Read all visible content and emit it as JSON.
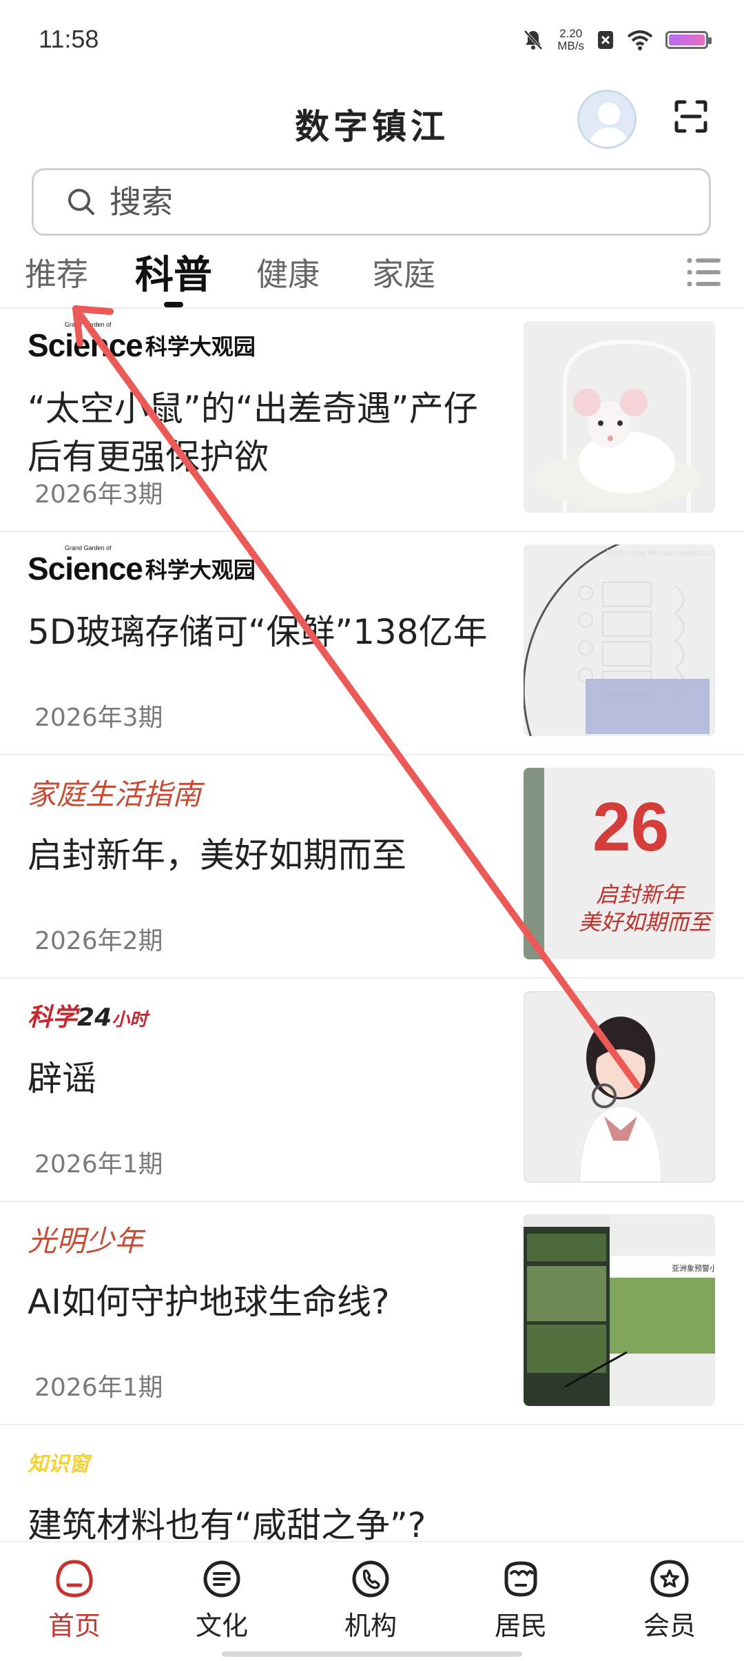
{
  "status_bar": {
    "time": "11:58",
    "net_speed_value": "2.20",
    "net_speed_unit": "MB/s"
  },
  "header": {
    "title": "数字镇江"
  },
  "search": {
    "placeholder": "搜索"
  },
  "tabs": [
    {
      "label": "推荐",
      "active": false
    },
    {
      "label": "科普",
      "active": true
    },
    {
      "label": "健康",
      "active": false
    },
    {
      "label": "家庭",
      "active": false
    }
  ],
  "feed": [
    {
      "source_type": "science",
      "source_en": "Science",
      "source_en_small": "Grand Garden of",
      "source_cn": "科学大观园",
      "title": "“太空小鼠”的“出差奇遇”产仔后有更强保护欲",
      "issue": "2026年3期",
      "thumb": "mouse-image"
    },
    {
      "source_type": "science",
      "source_en": "Science",
      "source_en_small": "Grand Garden of",
      "source_cn": "科学大观园",
      "title": "5D玻璃存储可“保鲜”138亿年",
      "issue": "2026年3期",
      "thumb": "glass-disc-image",
      "thumb_text": "Preserving Human Genetic Code Who Wants to Live Forever"
    },
    {
      "source_type": "text",
      "source_text": "家庭生活指南",
      "title": "启封新年，美好如期而至",
      "issue": "2026年2期",
      "thumb": "new-year-image",
      "thumb_text_top": "26",
      "thumb_text_line1": "启封新年",
      "thumb_text_line2": "美好如期而至"
    },
    {
      "source_type": "science24",
      "source_part1": "科学",
      "source_part2": "24",
      "source_part3": "小时",
      "title": "辟谣",
      "issue": "2026年1期",
      "thumb": "girl-with-magnifier-image"
    },
    {
      "source_type": "text",
      "source_text": "光明少年",
      "title": "AI如何守护地球生命线?",
      "issue": "2026年1期",
      "thumb": "forest-screenshot-image",
      "thumb_text": "亚洲象预警小程"
    },
    {
      "source_type": "yellow",
      "source_text": "知识窗",
      "title": "建筑材料也有“咸甜之争”?",
      "issue": "",
      "thumb": ""
    }
  ],
  "bottom_nav": [
    {
      "label": "首页",
      "icon": "home-icon",
      "active": true
    },
    {
      "label": "文化",
      "icon": "culture-icon",
      "active": false
    },
    {
      "label": "机构",
      "icon": "phone-icon",
      "active": false
    },
    {
      "label": "居民",
      "icon": "resident-icon",
      "active": false
    },
    {
      "label": "会员",
      "icon": "member-star-icon",
      "active": false
    }
  ],
  "colors": {
    "accent_red": "#c8322f",
    "source_red": "#c94a33",
    "annotation_arrow": "#ec5a57"
  }
}
